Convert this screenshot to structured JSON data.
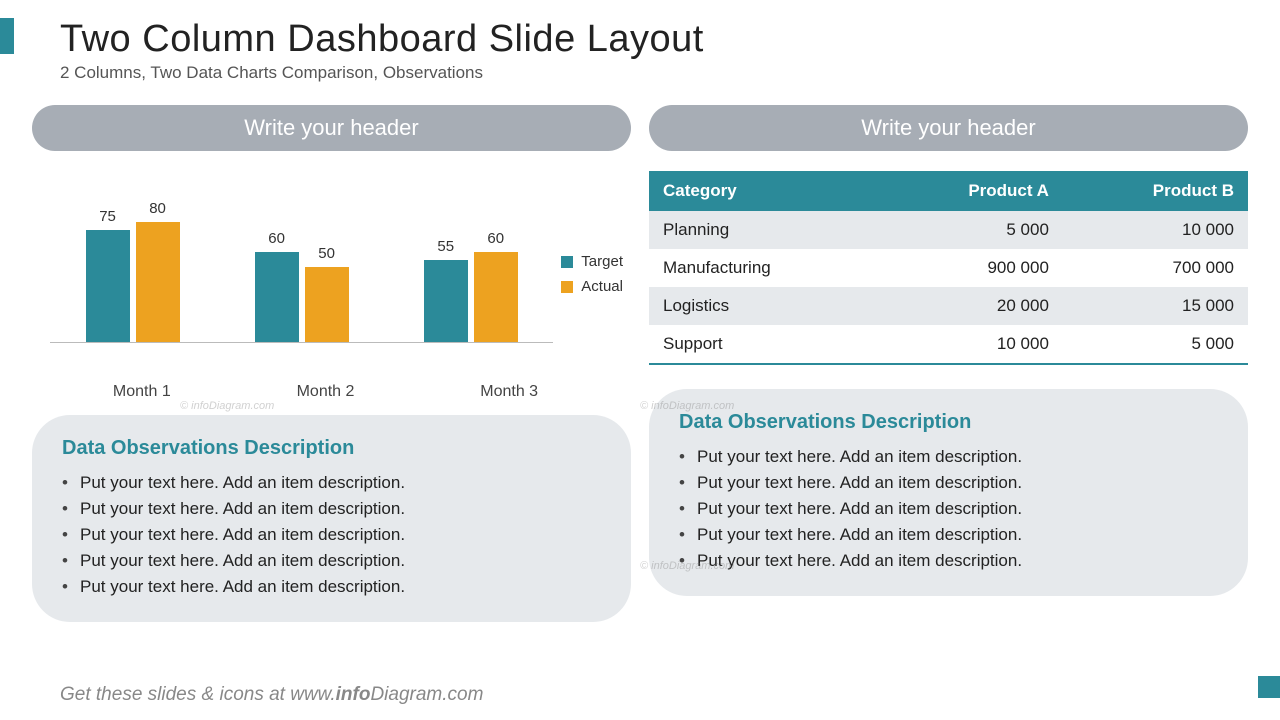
{
  "title": "Two Column Dashboard Slide Layout",
  "subtitle": "2 Columns, Two Data Charts Comparison, Observations",
  "left": {
    "header": "Write your header",
    "obs_title": "Data Observations Description",
    "bullets": [
      "Put your text here. Add an item description.",
      "Put your text here. Add an item description.",
      "Put your text here. Add an item description.",
      "Put your text here. Add an item description.",
      "Put your text here. Add an item description."
    ]
  },
  "right": {
    "header": "Write your header",
    "obs_title": "Data Observations Description",
    "bullets": [
      "Put your text here. Add an item description.",
      "Put your text here. Add an item description.",
      "Put your text here. Add an item description.",
      "Put your text here. Add an item description.",
      "Put your text here. Add an item description."
    ]
  },
  "table": {
    "headers": [
      "Category",
      "Product A",
      "Product B"
    ],
    "rows": [
      [
        "Planning",
        "5 000",
        "10 000"
      ],
      [
        "Manufacturing",
        "900 000",
        "700 000"
      ],
      [
        "Logistics",
        "20 000",
        "15 000"
      ],
      [
        "Support",
        "10 000",
        "5 000"
      ]
    ]
  },
  "legend": {
    "target": "Target",
    "actual": "Actual"
  },
  "chart_data": {
    "type": "bar",
    "categories": [
      "Month 1",
      "Month 2",
      "Month 3"
    ],
    "series": [
      {
        "name": "Target",
        "values": [
          75,
          60,
          55
        ],
        "color": "#2b8a99"
      },
      {
        "name": "Actual",
        "values": [
          80,
          50,
          60
        ],
        "color": "#eda220"
      }
    ],
    "ylim": [
      0,
      100
    ]
  },
  "footer": {
    "pre": "Get these slides & icons at www.",
    "bold": "info",
    "post": "Diagram.com"
  },
  "watermark": "© infoDiagram.com"
}
